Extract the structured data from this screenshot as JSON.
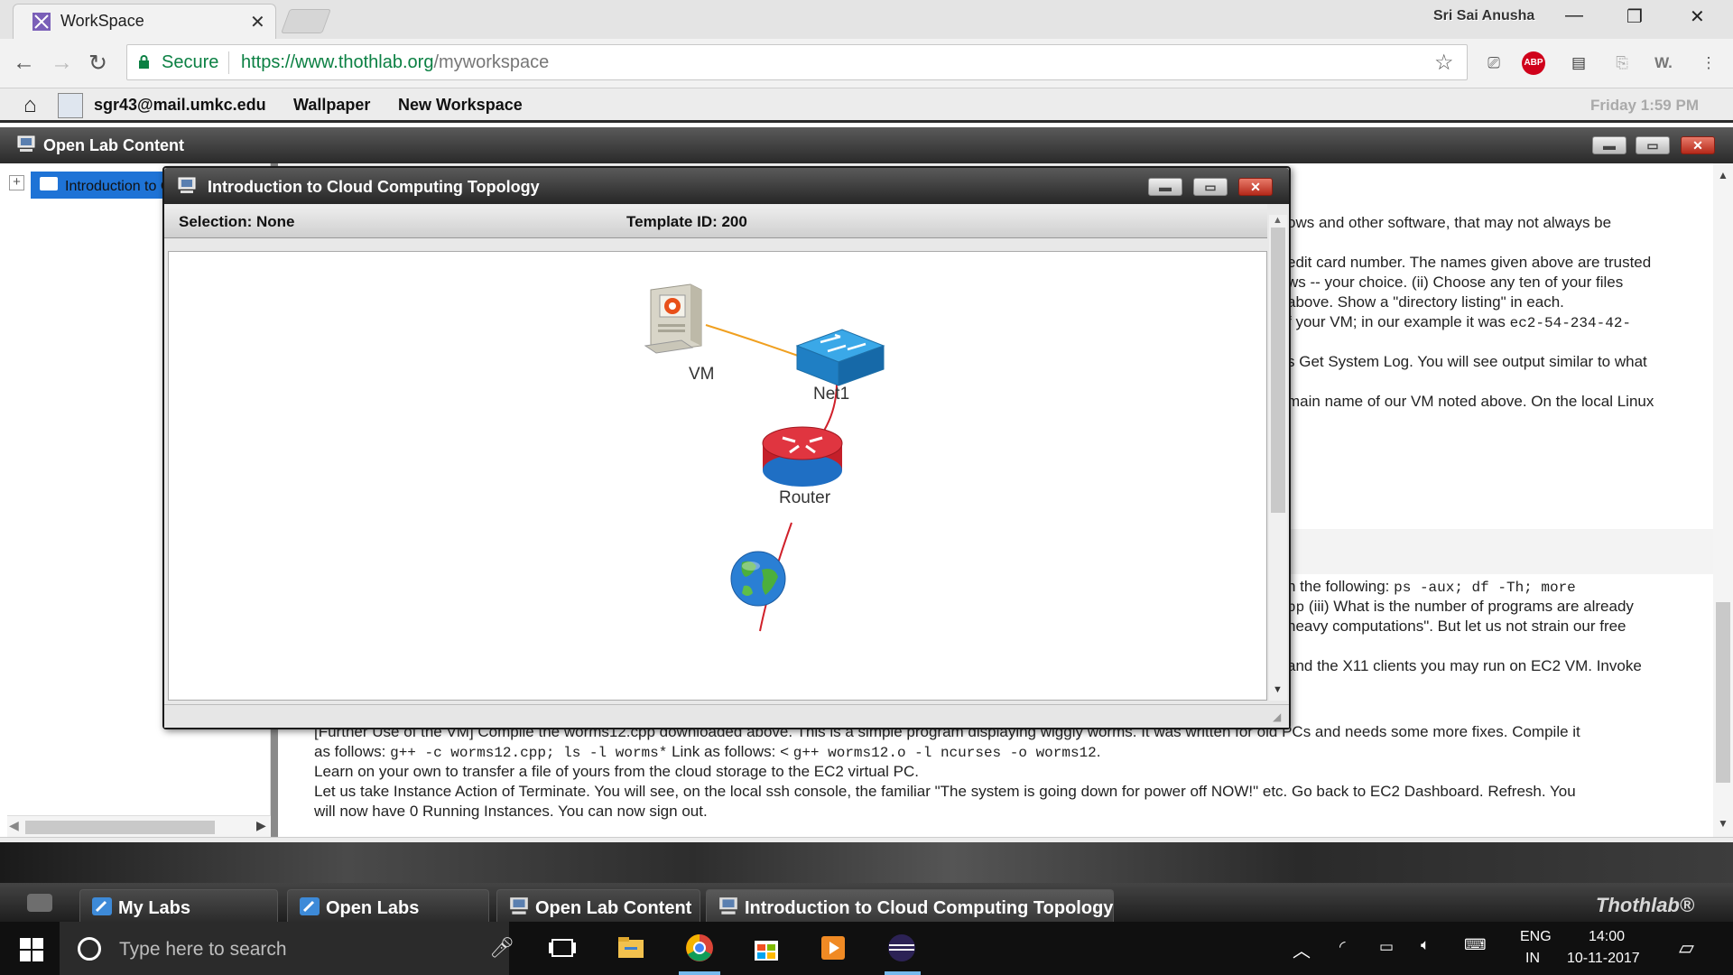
{
  "browser": {
    "tab_title": "WorkSpace",
    "profile_name": "Sri Sai Anusha",
    "secure_label": "Secure",
    "url_base": "https://www.thothlab.org",
    "url_path": "/myworkspace",
    "extensions": [
      "cast-icon",
      "adblock-icon",
      "film-icon",
      "pdf-icon",
      "w-icon",
      "menu-icon"
    ]
  },
  "appbar": {
    "user_email": "sgr43@mail.umkc.edu",
    "wallpaper_label": "Wallpaper",
    "new_workspace_label": "New Workspace",
    "clock": "Friday 1:59 PM"
  },
  "open_lab_window": {
    "title": "Open Lab Content",
    "tree_node_label": "Introduction to Cloud Computing"
  },
  "content_lines": [
    "ows and other software, that may not always be",
    "edit card number. The names given above are trusted",
    "ws -- your choice. (ii) Choose any ten of your files",
    " above. Show a \"directory listing\" in each.",
    "f your VM; in our example it was ",
    "ec2-54-234-42-",
    "s Get System Log. You will see output similar to what",
    "main name of our VM noted above. On the local Linux",
    "n the following: ",
    "ps -aux; df -Th; more",
    "pp",
    " (iii) What is the number of programs are already",
    "heavy computations\". But let us not strain our free",
    "and the X11 clients you may run on EC2 VM. Invoke",
    "[Further Use of the VM] Compile the worms12.cpp downloaded above. This is a simple program displaying wiggly worms. It was written for old PCs and needs some more fixes. Compile it",
    "as follows: ",
    "g++ -c worms12.cpp; ls -l worms*",
    " Link as follows: < ",
    "g++ worms12.o -l ncurses -o worms12",
    ".",
    "Learn on your own to transfer a file of yours from the cloud storage to the EC2 virtual PC.",
    "Let us take Instance Action of Terminate. You will see, on the local ssh console, the familiar \"The system is going down for power off NOW!\" etc. Go back to EC2 Dashboard. Refresh. You",
    "will now have 0 Running Instances. You can now sign out."
  ],
  "topology_window": {
    "title": "Introduction to Cloud Computing Topology",
    "selection": "Selection: None",
    "template_id": "Template ID: 200",
    "devices": [
      {
        "name": "VM",
        "icon": "vm-computer-icon"
      },
      {
        "name": "Net1",
        "icon": "network-switch-icon"
      },
      {
        "name": "Router",
        "icon": "router-icon"
      },
      {
        "name": "",
        "icon": "internet-globe-icon"
      }
    ],
    "links": [
      {
        "from": "VM",
        "to": "Net1",
        "color": "#f0a020"
      },
      {
        "from": "Net1",
        "to": "Router",
        "color": "#d0202a"
      },
      {
        "from": "Router",
        "to": "Internet",
        "color": "#d0202a"
      }
    ]
  },
  "thoth_taskbar": {
    "tasks": [
      "My Labs",
      "Open Labs",
      "Open Lab Content",
      "Introduction to Cloud Computing Topology"
    ],
    "brand": "Thothlab®"
  },
  "windows_taskbar": {
    "search_placeholder": "Type here to search",
    "lang_top": "ENG",
    "lang_bottom": "IN",
    "time": "14:00",
    "date": "10-11-2017"
  },
  "colors": {
    "secure_green": "#0b8043",
    "selection_blue": "#1e73d6",
    "window_title_dark": "#2a2a2a",
    "link_orange": "#f0a020",
    "link_red": "#d0202a"
  }
}
